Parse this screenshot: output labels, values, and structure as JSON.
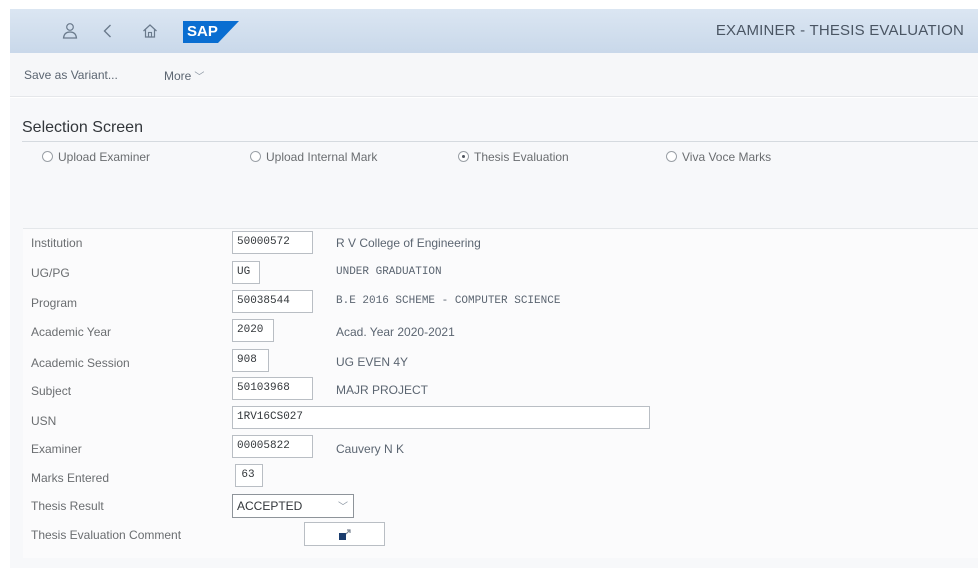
{
  "header": {
    "title": "EXAMINER - THESIS EVALUATION",
    "logo_text": "SAP",
    "icons": [
      "user-icon",
      "back-icon",
      "home-icon"
    ]
  },
  "toolbar": {
    "save_variant_label": "Save as Variant...",
    "more_label": "More"
  },
  "selection": {
    "title": "Selection Screen",
    "options": [
      {
        "label": "Upload Examiner",
        "selected": false
      },
      {
        "label": "Upload Internal Mark",
        "selected": false
      },
      {
        "label": "Thesis Evaluation",
        "selected": true
      },
      {
        "label": "Viva Voce Marks",
        "selected": false
      }
    ]
  },
  "form": {
    "institution": {
      "label": "Institution",
      "value": "50000572",
      "desc": "R V College of Engineering"
    },
    "ugpg": {
      "label": "UG/PG",
      "value": "UG",
      "desc": "UNDER GRADUATION"
    },
    "program": {
      "label": "Program",
      "value": "50038544",
      "desc": "B.E 2016 SCHEME - COMPUTER SCIENCE"
    },
    "academic_year": {
      "label": "Academic Year",
      "value": "2020",
      "desc": "Acad. Year 2020-2021"
    },
    "academic_session": {
      "label": "Academic Session",
      "value": "908",
      "desc": "UG EVEN 4Y"
    },
    "subject": {
      "label": "Subject",
      "value": "50103968",
      "desc": "MAJR PROJECT"
    },
    "usn": {
      "label": "USN",
      "value": "1RV16CS027"
    },
    "examiner": {
      "label": "Examiner",
      "value": "00005822",
      "desc": "Cauvery N K"
    },
    "marks": {
      "label": "Marks Entered",
      "value": "63"
    },
    "thesis_result": {
      "label": "Thesis Result",
      "value": "ACCEPTED"
    },
    "comment": {
      "label": "Thesis Evaluation Comment"
    }
  },
  "colors": {
    "shellbar": "#c9d8ea",
    "sap_blue": "#0a6ed1",
    "background": "#f7f8fa"
  }
}
